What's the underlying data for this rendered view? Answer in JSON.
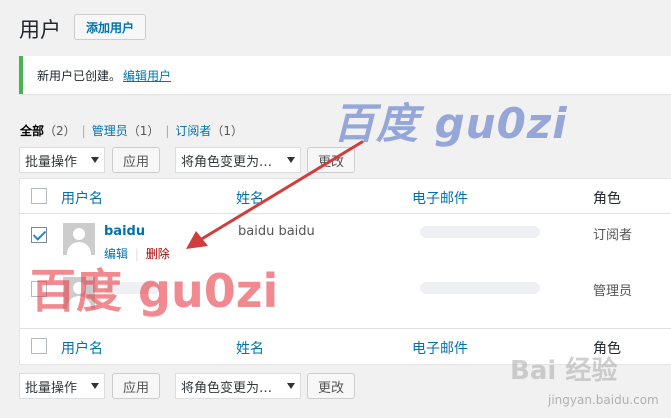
{
  "page": {
    "title": "用户",
    "add_button": "添加用户"
  },
  "notice": {
    "text": "新用户已创建。",
    "link": "编辑用户",
    "accent": "#46b450"
  },
  "filters": {
    "all_label": "全部",
    "all_count": "（2）",
    "admin_label": "管理员",
    "admin_count": "（1）",
    "sub_label": "订阅者",
    "sub_count": "（1）",
    "separator": "|"
  },
  "bulk_top": {
    "bulk_action": "批量操作",
    "apply": "应用",
    "role_change": "将角色变更为…",
    "change": "更改"
  },
  "bulk_bottom": {
    "bulk_action": "批量操作",
    "apply": "应用",
    "role_change": "将角色变更为…",
    "change": "更改"
  },
  "table": {
    "columns": {
      "username": "用户名",
      "name": "姓名",
      "email": "电子邮件",
      "role": "角色"
    },
    "rows": [
      {
        "username": "baidu",
        "name": "baidu baidu",
        "role": "订阅者",
        "checked": true,
        "action_edit": "编辑",
        "action_sep": "|",
        "action_delete": "删除"
      },
      {
        "username": "",
        "name": "",
        "role": "管理员",
        "checked": false
      }
    ]
  },
  "watermarks": {
    "blue": "百度 gu0zi",
    "red": "百度 gu0zi",
    "baidu_logo": "Bai 经验",
    "url": "jingyan.baidu.com"
  },
  "colors": {
    "link": "#0073aa",
    "delete": "#a00",
    "arrow": "#d23c3c"
  }
}
